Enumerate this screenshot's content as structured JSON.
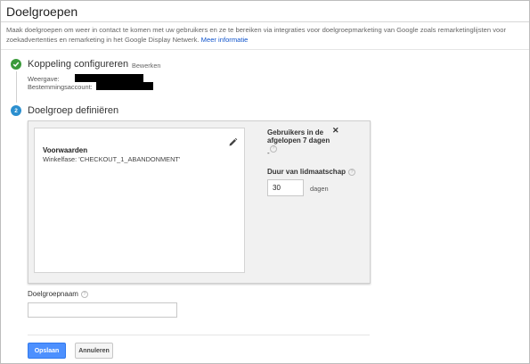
{
  "header": {
    "title": "Doelgroepen",
    "intro_text": "Maak doelgroepen om weer in contact te komen met uw gebruikers en ze te bereiken via integraties voor doelgroepmarketing van Google zoals remarketinglijsten voor zoekadvertenties en remarketing in het Google Display Netwerk. ",
    "more_info_link": "Meer informatie"
  },
  "step1": {
    "icon": "check-icon",
    "title": "Koppeling configureren",
    "edit_label": "Bewerken",
    "view_label": "Weergave:",
    "destination_label": "Bestemmingsaccount:"
  },
  "step2": {
    "number": "2",
    "title": "Doelgroep definiëren",
    "conditions_title": "Voorwaarden",
    "conditions_text": "Winkelfase: 'CHECKOUT_1_ABANDONMENT'",
    "users_label": "Gebruikers in de afgelopen 7 dagen",
    "users_value": "-",
    "duration_label": "Duur van lidmaatschap",
    "duration_value": "30",
    "duration_unit": "dagen"
  },
  "form": {
    "name_label": "Doelgroepnaam",
    "name_value": ""
  },
  "actions": {
    "save_label": "Opslaan",
    "cancel_label": "Annuleren"
  },
  "colors": {
    "accent": "#4d90fe",
    "step_done": "#3a9a3a",
    "step_active": "#2b8fcf",
    "link": "#1155cc"
  }
}
